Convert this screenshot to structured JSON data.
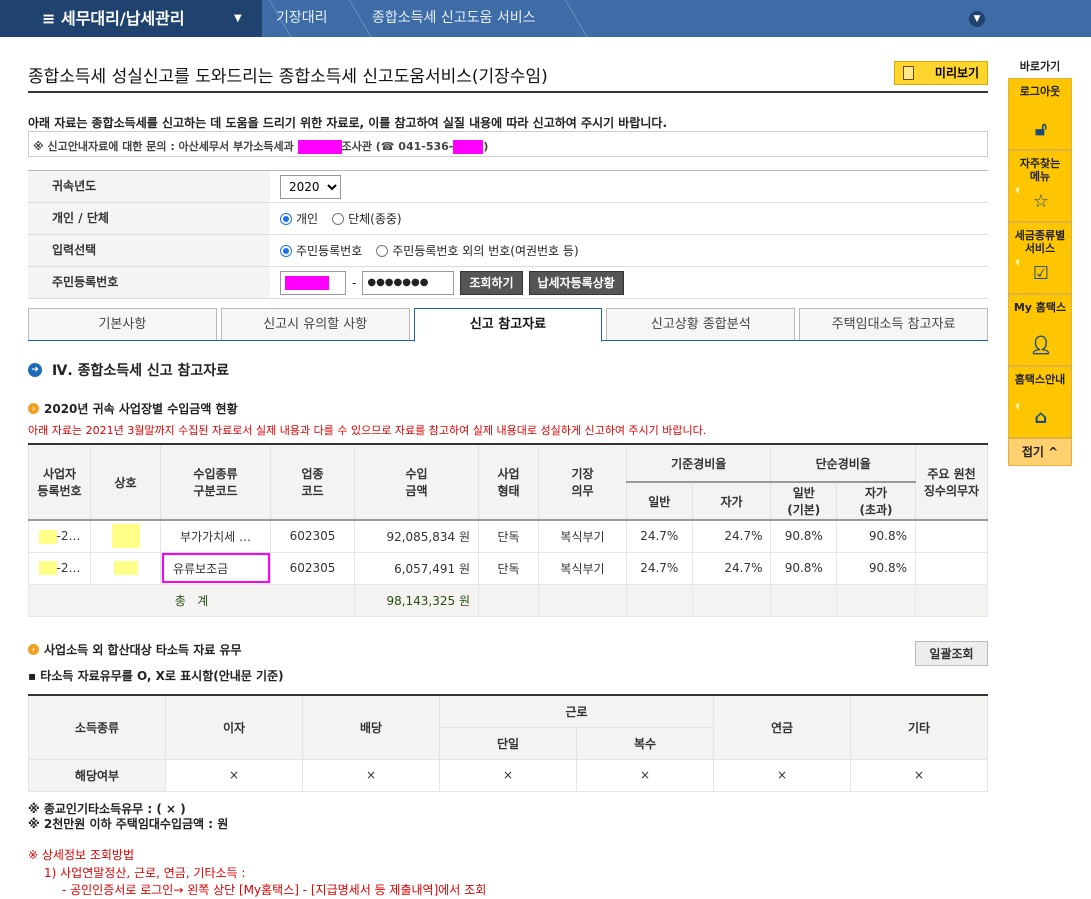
{
  "nav": {
    "menu": "세무대리/납세관리",
    "crumbs": [
      "기장대리",
      "종합소득세 신고도움 서비스"
    ]
  },
  "title": "종합소득세 성실신고를 도와드리는 종합소득세 신고도움서비스(기장수임)",
  "preview": "미리보기",
  "intro": "아래 자료는 종합소득세를 신고하는 데 도움을 드리기 위한 자료로, 이를 참고하여 실질 내용에 따라 신고하여 주시기 바랍니다.",
  "info": {
    "prefix": "※ 신고안내자료에 대한 문의 : 아산세무서 부가소득세과 ",
    "mid": "조사관 (☎ 041-536-",
    "suffix": ")"
  },
  "form": {
    "year_label": "귀속년도",
    "year": "2020",
    "type_label": "개인 / 단체",
    "type_opts": [
      "개인",
      "단체(종중)"
    ],
    "input_label": "입력선택",
    "input_opts": [
      "주민등록번호",
      "주민등록번호 외의 번호(여권번호 등)"
    ],
    "rrn_label": "주민등록번호",
    "rrn_dash": "-",
    "rrn_back": "●●●●●●●",
    "search": "조회하기",
    "status": "납세자등록상황"
  },
  "tabs": [
    "기본사항",
    "신고시 유의할 사항",
    "신고 참고자료",
    "신고상황 종합분석",
    "주택임대소득 참고자료"
  ],
  "section": "Ⅳ. 종합소득세 신고 참고자료",
  "sub1": "2020년 귀속 사업장별 수입금액 현황",
  "red1": "아래 자료는 2021년 3월말까지 수집된 자료로서 실제 내용과 다를 수 있으므로 자료를 참고하여 실제 내용대로 성실하게 신고하여 주시기 바랍니다.",
  "t1": {
    "h": [
      "사업자\n등록번호",
      "상호",
      "수입종류\n구분코드",
      "업종\n코드",
      "수입\n금액",
      "사업\n형태",
      "기장\n의무",
      "기준경비율",
      "단순경비율",
      "주요 원천\n징수의무자"
    ],
    "h2": [
      "일반",
      "자가",
      "일반\n(기본)",
      "자가\n(초과)"
    ],
    "rows": [
      {
        "reg": "-2…",
        "type": "부가가치세 …",
        "code": "602305",
        "amt": "92,085,834 원",
        "form": "단독",
        "duty": "복식부기",
        "a": "24.7%",
        "b": "24.7%",
        "c": "90.8%",
        "d": "90.8%"
      },
      {
        "reg": "-2…",
        "type": "유류보조금",
        "code": "602305",
        "amt": "6,057,491 원",
        "form": "단독",
        "duty": "복식부기",
        "a": "24.7%",
        "b": "24.7%",
        "c": "90.8%",
        "d": "90.8%"
      }
    ],
    "total_label": "총   계",
    "total": "98,143,325 원"
  },
  "sub2": "사업소득 외 합산대상 타소득 자료 유무",
  "bulk": "일괄조회",
  "sub2note": "▪ 타소득 자료유무를 O, X로 표시함(안내문 기준)",
  "t2": {
    "h": [
      "소득종류",
      "이자",
      "배당",
      "근로",
      "연금",
      "기타"
    ],
    "h2": [
      "단일",
      "복수"
    ],
    "row_label": "해당여부",
    "vals": [
      "×",
      "×",
      "×",
      "×",
      "×",
      "×"
    ]
  },
  "notes": [
    "※ 종교인기타소득유무 : ( × )",
    "※ 2천만원 이하 주택임대수입금액 : 원"
  ],
  "red2": [
    "※  상세정보 조회방법",
    "1) 사업연말정산, 근로, 연금, 기타소득 :",
    "- 공인인증서로 로그인→ 왼쪽 상단 [My홈택스] - [지급명세서 등 제출내역]에서 조회"
  ],
  "side": {
    "title": "바로가기",
    "items": [
      "로그아웃",
      "자주찾는\n메뉴",
      "세금종류별\n서비스",
      "My 홈택스",
      "홈택스안내"
    ],
    "fold": "접기 ^"
  }
}
